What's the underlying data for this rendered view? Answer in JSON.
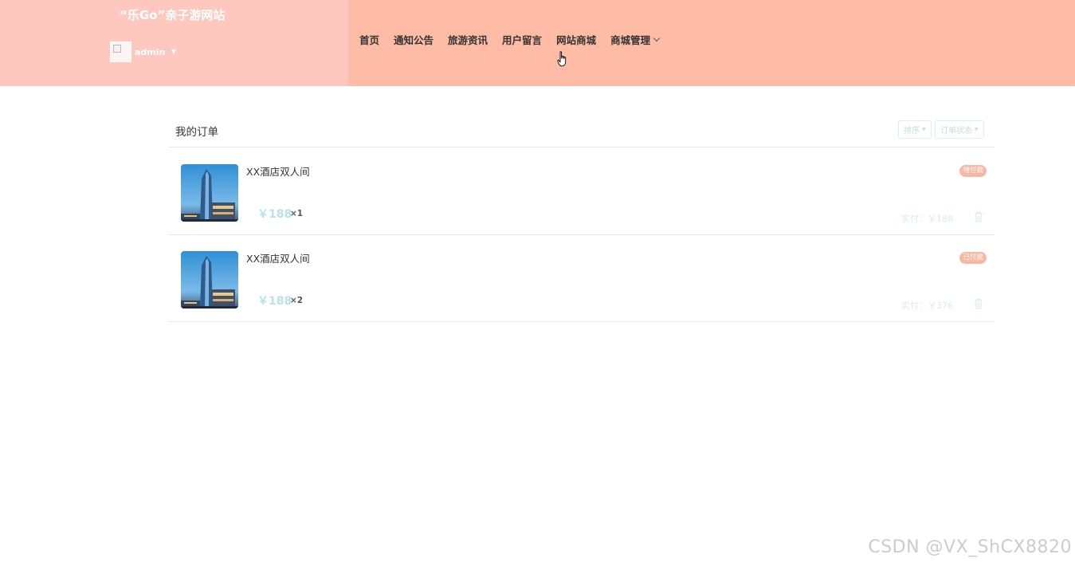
{
  "header": {
    "site_title": "“乐Go”亲子游网站",
    "username": "admin",
    "user_caret": "▼",
    "nav": [
      {
        "label": "首页"
      },
      {
        "label": "通知公告"
      },
      {
        "label": "旅游资讯"
      },
      {
        "label": "用户留言"
      },
      {
        "label": "网站商城"
      },
      {
        "label": "商城管理"
      }
    ],
    "nav_dropdown_icon": "chevron-down-icon",
    "colors": {
      "brand_bg": "#fec8be",
      "nav_bg": "#febca6"
    }
  },
  "orders": {
    "title": "我的订单",
    "sort_label": "排序",
    "status_filter_label": "订单状态",
    "dropdown_caret": "▼",
    "items": [
      {
        "name": "XX酒店双人间",
        "price": "￥188",
        "quantity": "×1",
        "status": "待付款",
        "paid": "实付：￥188"
      },
      {
        "name": "XX酒店双人间",
        "price": "￥188",
        "quantity": "×2",
        "status": "已付款",
        "paid": "实付：￥376"
      }
    ],
    "colors": {
      "price": "#b8e2e8",
      "status_badge": "#f7b9a3"
    }
  },
  "watermark": "CSDN @VX_ShCX8820"
}
